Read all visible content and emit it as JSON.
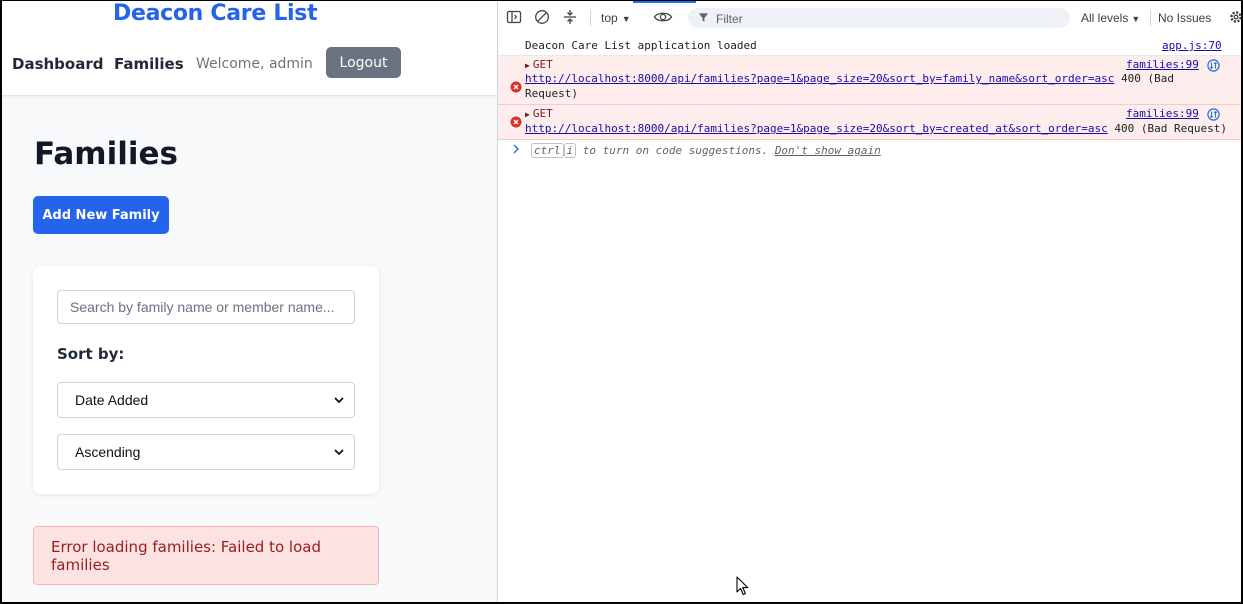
{
  "app": {
    "brand": "Deacon Care List",
    "nav": {
      "dashboard": "Dashboard",
      "families": "Families",
      "welcome": "Welcome, admin",
      "logout": "Logout"
    },
    "page_title": "Families",
    "add_button": "Add New Family",
    "filters": {
      "search_placeholder": "Search by family name or member name...",
      "sort_label": "Sort by:",
      "sort_field": "Date Added",
      "sort_order": "Ascending"
    },
    "error_message": "Error loading families: Failed to load families"
  },
  "devtools": {
    "toolbar": {
      "context": "top",
      "filter_placeholder": "Filter",
      "levels": "All levels",
      "issues": "No Issues"
    },
    "console": {
      "info": {
        "text": "Deacon Care List application loaded",
        "source": "app.js:70"
      },
      "errors": [
        {
          "method": "GET",
          "url": "http://localhost:8000/api/families?page=1&page_size=20&sort_by=family_name&sort_order=asc",
          "status_line1": "400 (Bad",
          "status_line2": "Request)",
          "source": "families:99"
        },
        {
          "method": "GET",
          "url": "http://localhost:8000/api/families?page=1&page_size=20&sort_by=created_at&sort_order=asc",
          "status": "400 (Bad Request)",
          "source": "families:99"
        }
      ],
      "hint": {
        "key1": "ctrl",
        "key2": "i",
        "text": "to turn on code suggestions.",
        "link": "Don't show again"
      }
    }
  },
  "colors": {
    "brand": "#2563eb",
    "error_bg": "#fde2e2",
    "error_text": "#9b1c1c",
    "logout_bg": "#6b7280",
    "console_error_bg": "#fdeded"
  }
}
